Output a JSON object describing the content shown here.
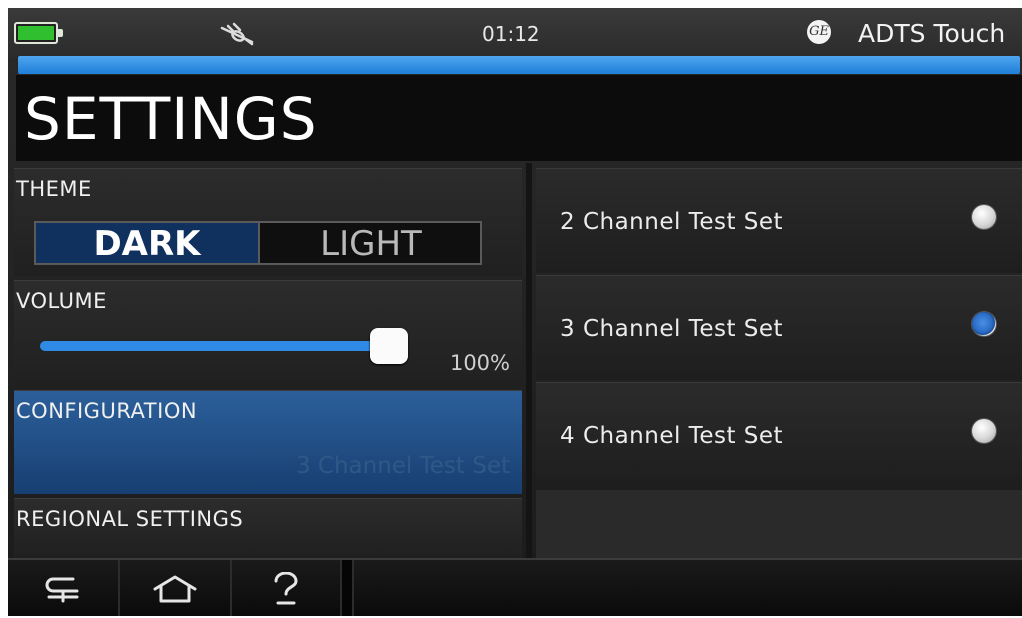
{
  "status": {
    "time": "01:12",
    "device_name": "ADTS Touch",
    "logo_text": "GE",
    "battery_color": "#2fbf2f",
    "progress_fraction": 1.0
  },
  "page": {
    "title": "SETTINGS"
  },
  "theme": {
    "label": "THEME",
    "options": [
      "DARK",
      "LIGHT"
    ],
    "selected": "DARK"
  },
  "volume": {
    "label": "VOLUME",
    "value_text": "100%",
    "level": 1.0
  },
  "configuration": {
    "label": "CONFIGURATION",
    "value": "3 Channel Test Set"
  },
  "regional": {
    "label": "REGIONAL SETTINGS"
  },
  "config_options": [
    {
      "label": "2 Channel Test Set",
      "selected": false
    },
    {
      "label": "3 Channel Test Set",
      "selected": true
    },
    {
      "label": "4 Channel Test Set",
      "selected": false
    }
  ],
  "navigation": {
    "icons": [
      "back-icon",
      "home-icon",
      "help-icon"
    ]
  },
  "colors": {
    "accent": "#2f8ae6",
    "selected_panel": "#1f4d86"
  }
}
